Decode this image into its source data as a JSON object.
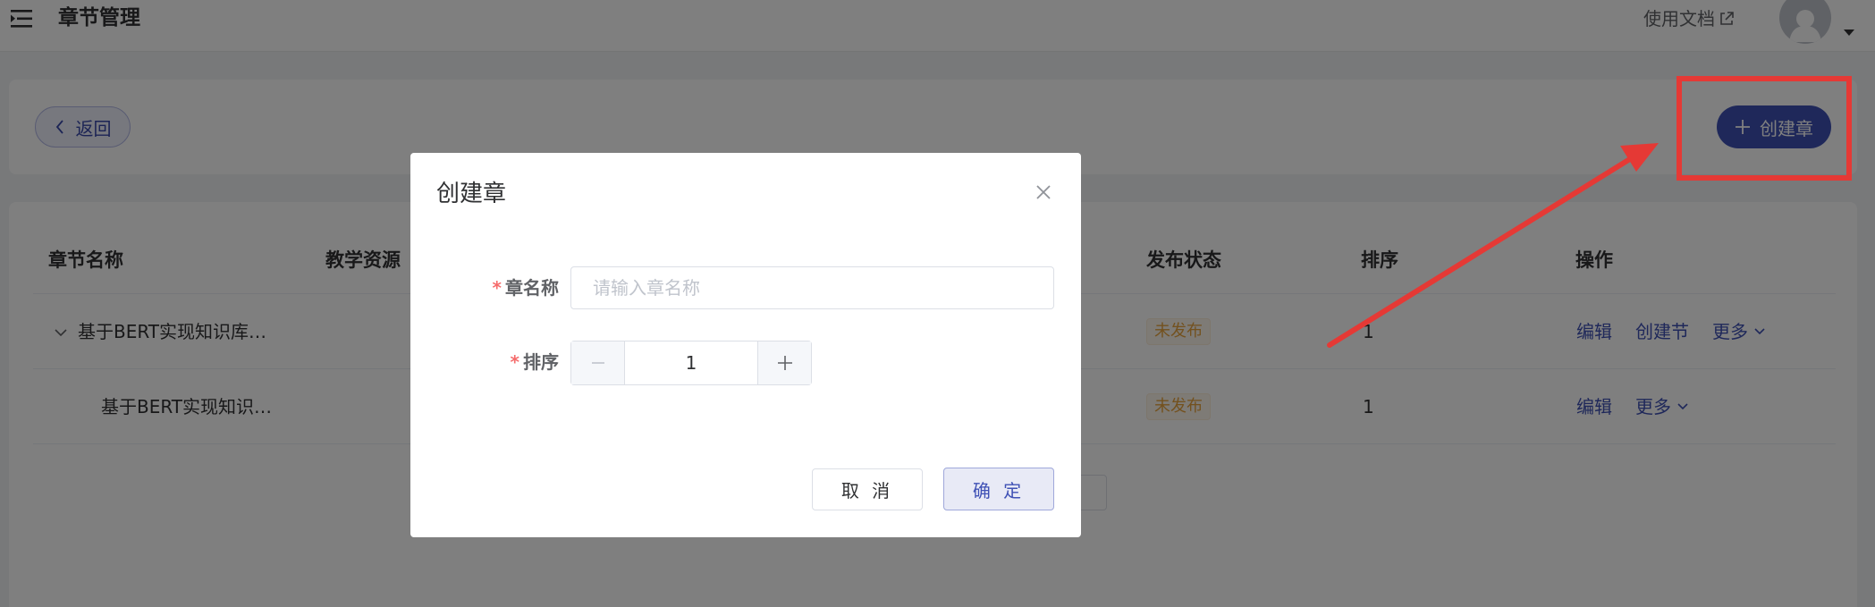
{
  "header": {
    "title": "章节管理",
    "docs_label": "使用文档",
    "menu_icon": "menu-fold-icon",
    "external_icon": "external-link-icon",
    "avatar_icon": "user-avatar-icon"
  },
  "toolbar": {
    "back_label": "返回",
    "create_chapter_label": "创建章"
  },
  "table": {
    "columns": [
      "章节名称",
      "教学资源",
      "发布状态",
      "排序",
      "操作"
    ],
    "rows": [
      {
        "name": "基于BERT实现知识库…",
        "status": "未发布",
        "order": "1",
        "actions": [
          "编辑",
          "创建节",
          "更多"
        ],
        "expandable": true
      },
      {
        "name": "基于BERT实现知识…",
        "status": "未发布",
        "order": "1",
        "actions": [
          "编辑",
          "更多"
        ],
        "expandable": false
      }
    ]
  },
  "dialog": {
    "title": "创建章",
    "fields": {
      "name": {
        "label": "章名称",
        "required_mark": "*",
        "placeholder": "请输入章名称",
        "value": ""
      },
      "order": {
        "label": "排序",
        "required_mark": "*",
        "value": "1"
      }
    },
    "cancel_label": "取 消",
    "confirm_label": "确 定"
  },
  "colors": {
    "primary": "#3f51b5",
    "annotation": "#e53935",
    "warning_text": "#e6a23c",
    "required": "#f56c6c"
  }
}
